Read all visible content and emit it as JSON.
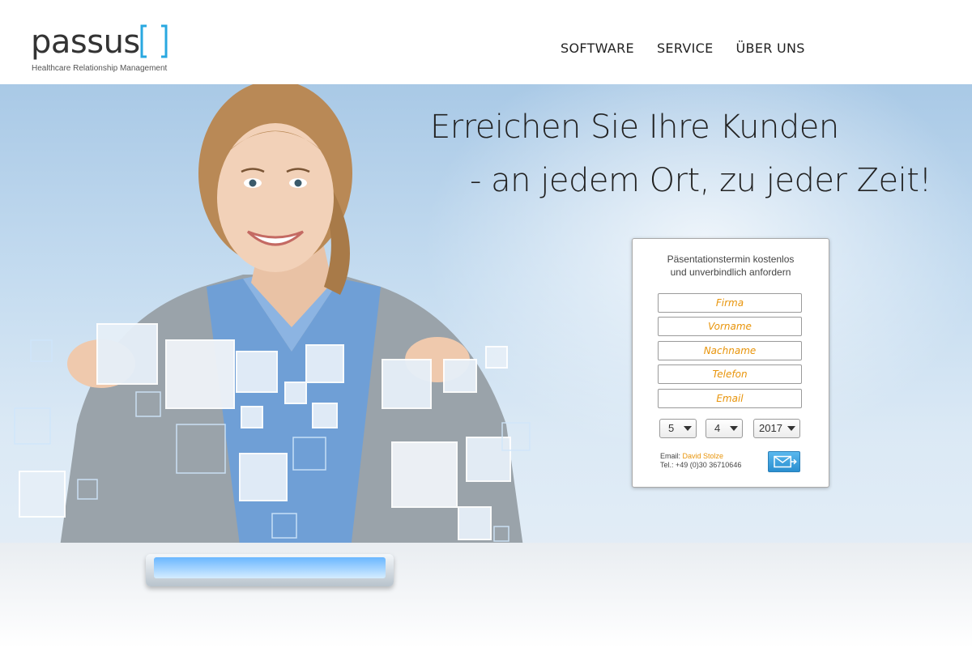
{
  "logo": {
    "name": "passus",
    "tagline": "Healthcare Relationship Management"
  },
  "nav": {
    "items": [
      {
        "label": "SOFTWARE"
      },
      {
        "label": "SERVICE"
      },
      {
        "label": "ÜBER UNS"
      }
    ]
  },
  "hero": {
    "headline_line1": "Erreichen Sie Ihre Kunden",
    "headline_line2": "- an jedem Ort, zu jeder Zeit!"
  },
  "form": {
    "title_line1": "Päsentationstermin kostenlos",
    "title_line2": "und unverbindlich anfordern",
    "fields": [
      {
        "label": "Firma"
      },
      {
        "label": "Vorname"
      },
      {
        "label": "Nachname"
      },
      {
        "label": "Telefon"
      },
      {
        "label": "Email"
      }
    ],
    "date": {
      "day": "5",
      "month": "4",
      "year": "2017"
    },
    "contact": {
      "email_label": "Email:",
      "email_name": "David Stolze",
      "phone_line": "Tel.: +49 (0)30 36710646"
    }
  },
  "colors": {
    "accent_orange": "#e8940a",
    "brand_blue": "#29a8e0",
    "button_blue": "#2a8fd0"
  },
  "icons": {
    "send": "envelope-send-icon",
    "select_arrow": "chevron-down-icon"
  }
}
